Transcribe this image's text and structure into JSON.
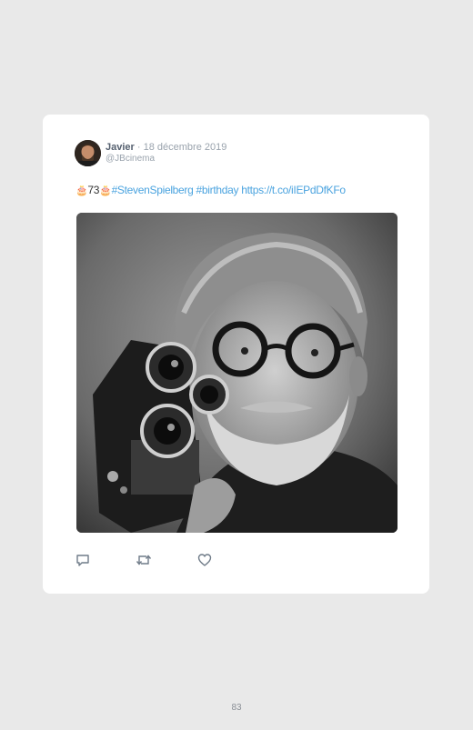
{
  "tweet": {
    "author_name": "Javier",
    "separator": "·",
    "date": "18 décembre 2019",
    "handle": "@JBcinema",
    "text": {
      "emoji_left": "🎂",
      "count": "73",
      "emoji_right": "🎂",
      "hashtag_1": "#StevenSpielberg",
      "hashtag_2": "#birthday",
      "url": "https://t.co/iIEPdDfKFo"
    },
    "photo_icon": "portrait-photo-with-camera",
    "actions": {
      "reply_icon": "reply-icon",
      "retweet_icon": "retweet-icon",
      "like_icon": "heart-icon"
    }
  },
  "colors": {
    "background": "#e9e9e9",
    "card": "#ffffff",
    "link": "#4aa3df",
    "muted": "#9aa3ad",
    "icon": "#6f7b88"
  },
  "page": {
    "number": "83"
  }
}
